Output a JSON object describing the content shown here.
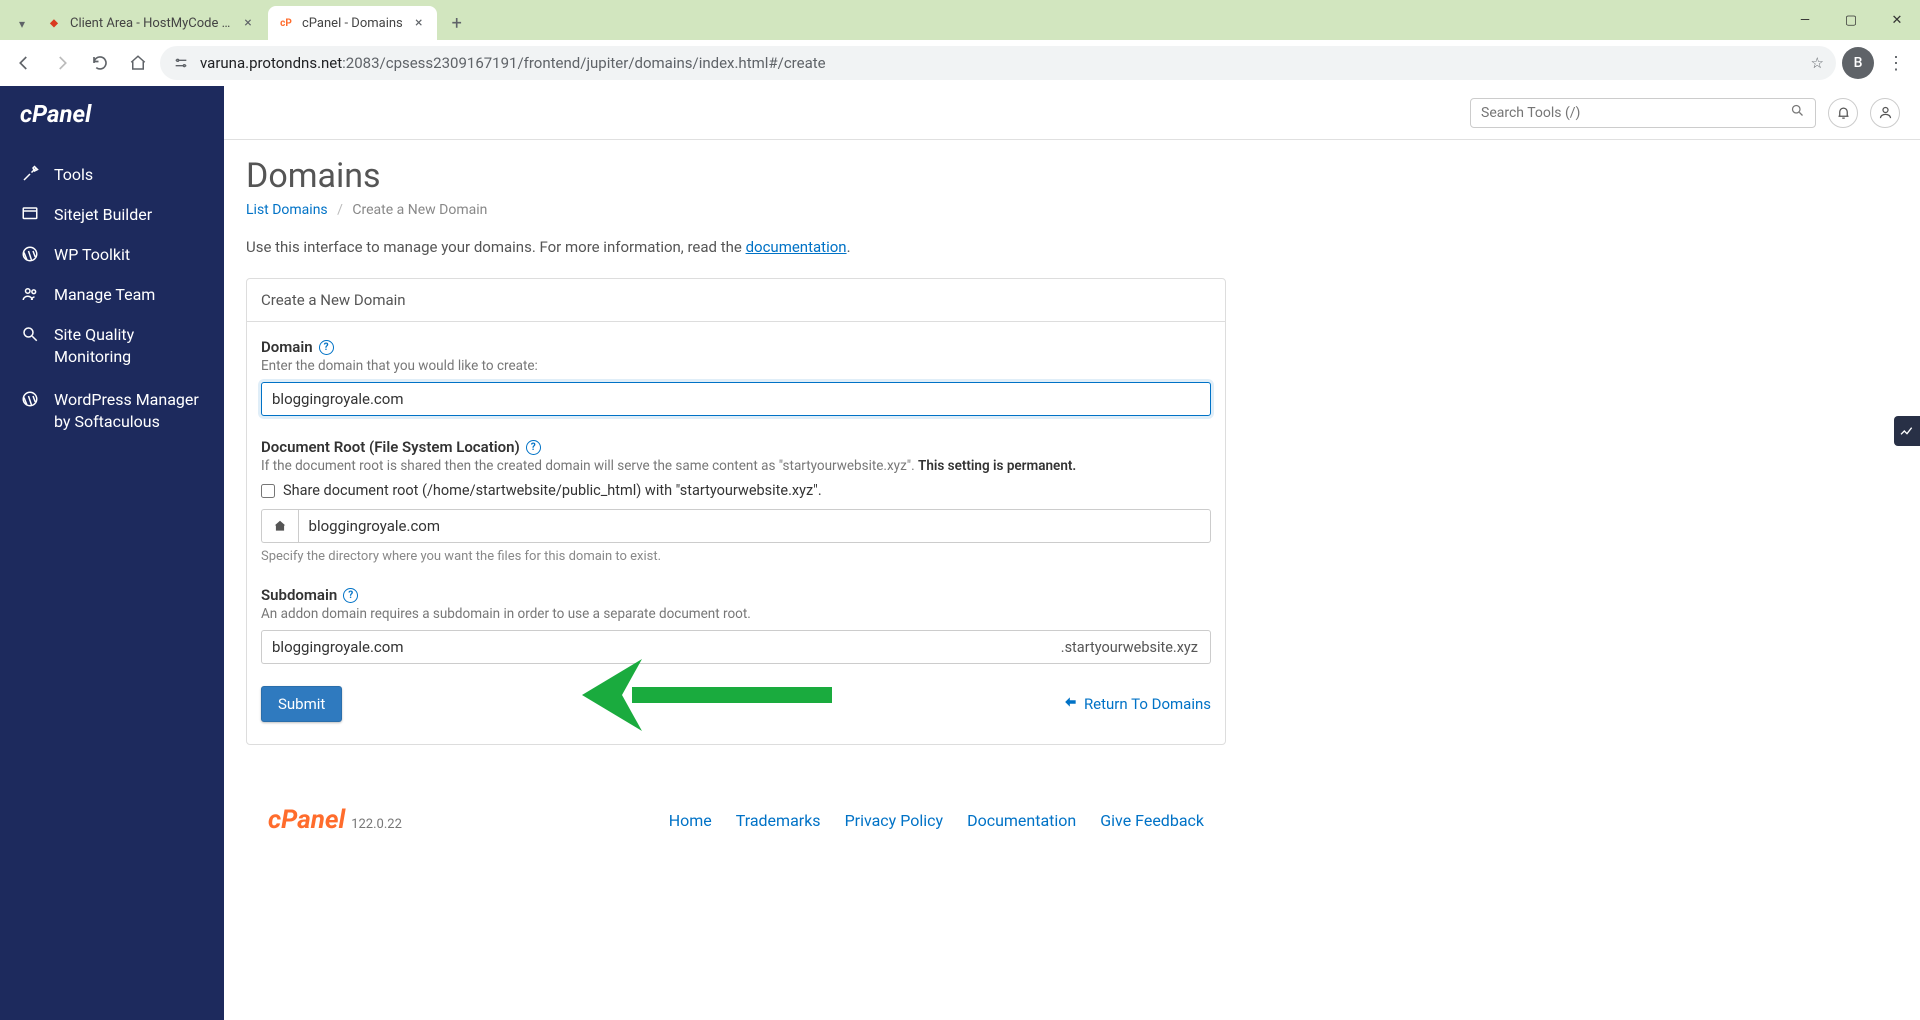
{
  "browser": {
    "tabs": [
      {
        "title": "Client Area - HostMyCode Web",
        "favicon_color": "#d9391f"
      },
      {
        "title": "cPanel - Domains",
        "favicon_color": "#ff6c2c"
      }
    ],
    "url_host": "varuna.protondns.net",
    "url_path": ":2083/cpsess2309167191/frontend/jupiter/domains/index.html#/create",
    "profile_initial": "B"
  },
  "sidebar": {
    "items": [
      {
        "label": "Tools"
      },
      {
        "label": "Sitejet Builder"
      },
      {
        "label": "WP Toolkit"
      },
      {
        "label": "Manage Team"
      },
      {
        "label": "Site Quality Monitoring"
      },
      {
        "label": "WordPress Manager by Softaculous"
      }
    ]
  },
  "topbar": {
    "search_placeholder": "Search Tools (/)"
  },
  "page": {
    "title": "Domains",
    "crumb_list": "List Domains",
    "crumb_current": "Create a New Domain",
    "intro_prefix": "Use this interface to manage your domains. For more information, read the ",
    "intro_link": "documentation",
    "panel_title": "Create a New Domain",
    "domain": {
      "label": "Domain",
      "hint": "Enter the domain that you would like to create:",
      "value": "bloggingroyale.com"
    },
    "docroot": {
      "label": "Document Root (File System Location)",
      "hint_prefix": "If the document root is shared then the created domain will serve the same content as \"startyourwebsite.xyz\". ",
      "hint_bold": "This setting is permanent.",
      "checkbox_label": "Share document root (/home/startwebsite/public_html) with \"startyourwebsite.xyz\".",
      "value": "bloggingroyale.com",
      "below": "Specify the directory where you want the files for this domain to exist."
    },
    "subdomain": {
      "label": "Subdomain",
      "hint": "An addon domain requires a subdomain in order to use a separate document root.",
      "value": "bloggingroyale.com",
      "suffix": ".startyourwebsite.xyz"
    },
    "submit": "Submit",
    "return": "Return To Domains"
  },
  "footer": {
    "brand": "cPanel",
    "version": "122.0.22",
    "links": [
      "Home",
      "Trademarks",
      "Privacy Policy",
      "Documentation",
      "Give Feedback"
    ]
  }
}
